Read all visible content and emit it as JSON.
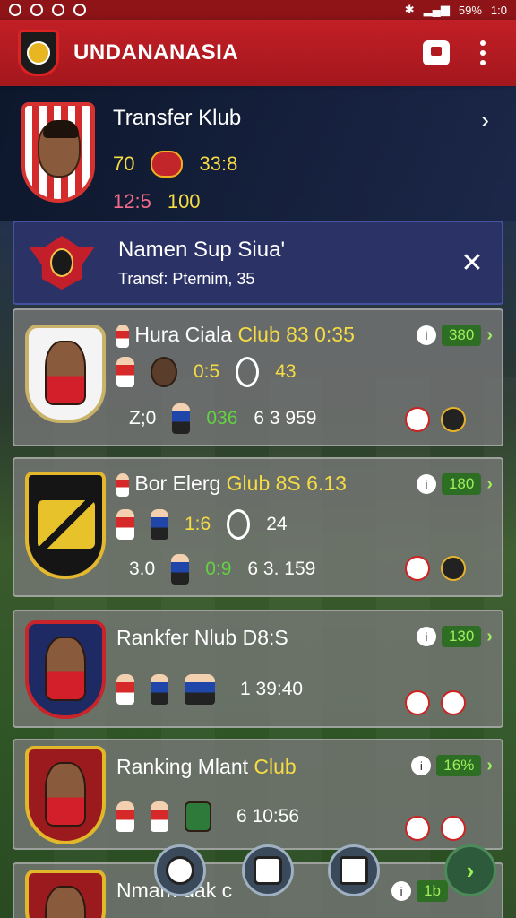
{
  "status_bar": {
    "right_text": "59%",
    "time": "1:0"
  },
  "app_bar": {
    "title": "UNDANANASIA",
    "icons": [
      "grid-icon",
      "more-icon"
    ]
  },
  "hero": {
    "title": "Transfer Klub",
    "row1_left": "70",
    "row1_right": "33:8",
    "row2_left": "12:5",
    "row2_right": "100"
  },
  "notification": {
    "title": "Namen Sup Siua'",
    "subtitle": "Transf: Pternim, 35"
  },
  "cards": [
    {
      "title_a": "Hura Ciala",
      "title_b": "Club 83 0:35",
      "row1_a": "0:5",
      "row1_b": "43",
      "row2_a": "Z;0",
      "row2_b": "036",
      "row2_c": "6 3 959",
      "badge_value": "380"
    },
    {
      "title_a": "Bor Elerg",
      "title_b": "Glub 8S 6.13",
      "row1_a": "1:6",
      "row1_b": "24",
      "row2_a": "3.0",
      "row2_b": "0:9",
      "row2_c": "6 3. 159",
      "badge_value": "180"
    },
    {
      "title": "Rankfer Nlub D8:S",
      "row_value": "1 39:40",
      "badge_value": "130"
    },
    {
      "title_a": "Ranking Mlant",
      "title_b": "Club",
      "row_value": "6 10:56",
      "badge_value": "16%"
    },
    {
      "title": "Nmam    uak  c",
      "badge_value": "1b"
    }
  ],
  "colors": {
    "brand_red": "#c21f26",
    "accent_green": "#9df05a",
    "accent_yellow": "#f5dc45"
  }
}
